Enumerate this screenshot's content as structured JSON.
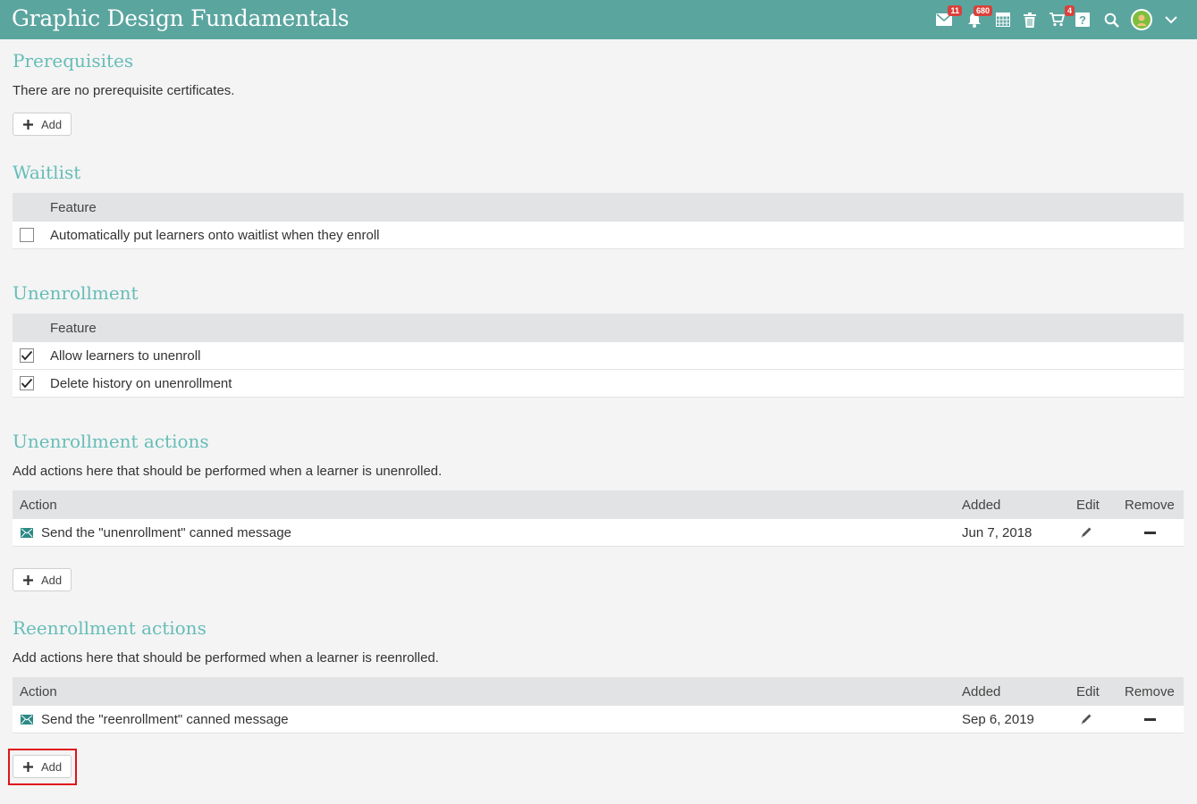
{
  "header": {
    "title": "Graphic Design Fundamentals",
    "badges": {
      "messages": "11",
      "notifications": "680",
      "cart": "4"
    },
    "icons": [
      "mail-icon",
      "bell-icon",
      "calendar-icon",
      "trash-icon",
      "cart-icon",
      "help-icon",
      "search-icon",
      "avatar",
      "chevron-down-icon"
    ]
  },
  "prerequisites": {
    "title": "Prerequisites",
    "text": "There are no prerequisite certificates.",
    "add_label": "Add"
  },
  "waitlist": {
    "title": "Waitlist",
    "header": "Feature",
    "rows": [
      {
        "label": "Automatically put learners onto waitlist when they enroll",
        "checked": false
      }
    ]
  },
  "unenrollment": {
    "title": "Unenrollment",
    "header": "Feature",
    "rows": [
      {
        "label": "Allow learners to unenroll",
        "checked": true
      },
      {
        "label": "Delete history on unenrollment",
        "checked": true
      }
    ]
  },
  "unenrollment_actions": {
    "title": "Unenrollment actions",
    "text": "Add actions here that should be performed when a learner is unenrolled.",
    "columns": {
      "action": "Action",
      "added": "Added",
      "edit": "Edit",
      "remove": "Remove"
    },
    "rows": [
      {
        "action": "Send the \"unenrollment\" canned message",
        "added": "Jun 7, 2018"
      }
    ],
    "add_label": "Add"
  },
  "reenrollment_actions": {
    "title": "Reenrollment actions",
    "text": "Add actions here that should be performed when a learner is reenrolled.",
    "columns": {
      "action": "Action",
      "added": "Added",
      "edit": "Edit",
      "remove": "Remove"
    },
    "rows": [
      {
        "action": "Send the \"reenrollment\" canned message",
        "added": "Sep 6, 2019"
      }
    ],
    "add_label": "Add"
  },
  "colors": {
    "header_bg": "#5ba59f",
    "section_title": "#66bdb8",
    "badge": "#d9413b",
    "highlight": "#e0141a"
  }
}
